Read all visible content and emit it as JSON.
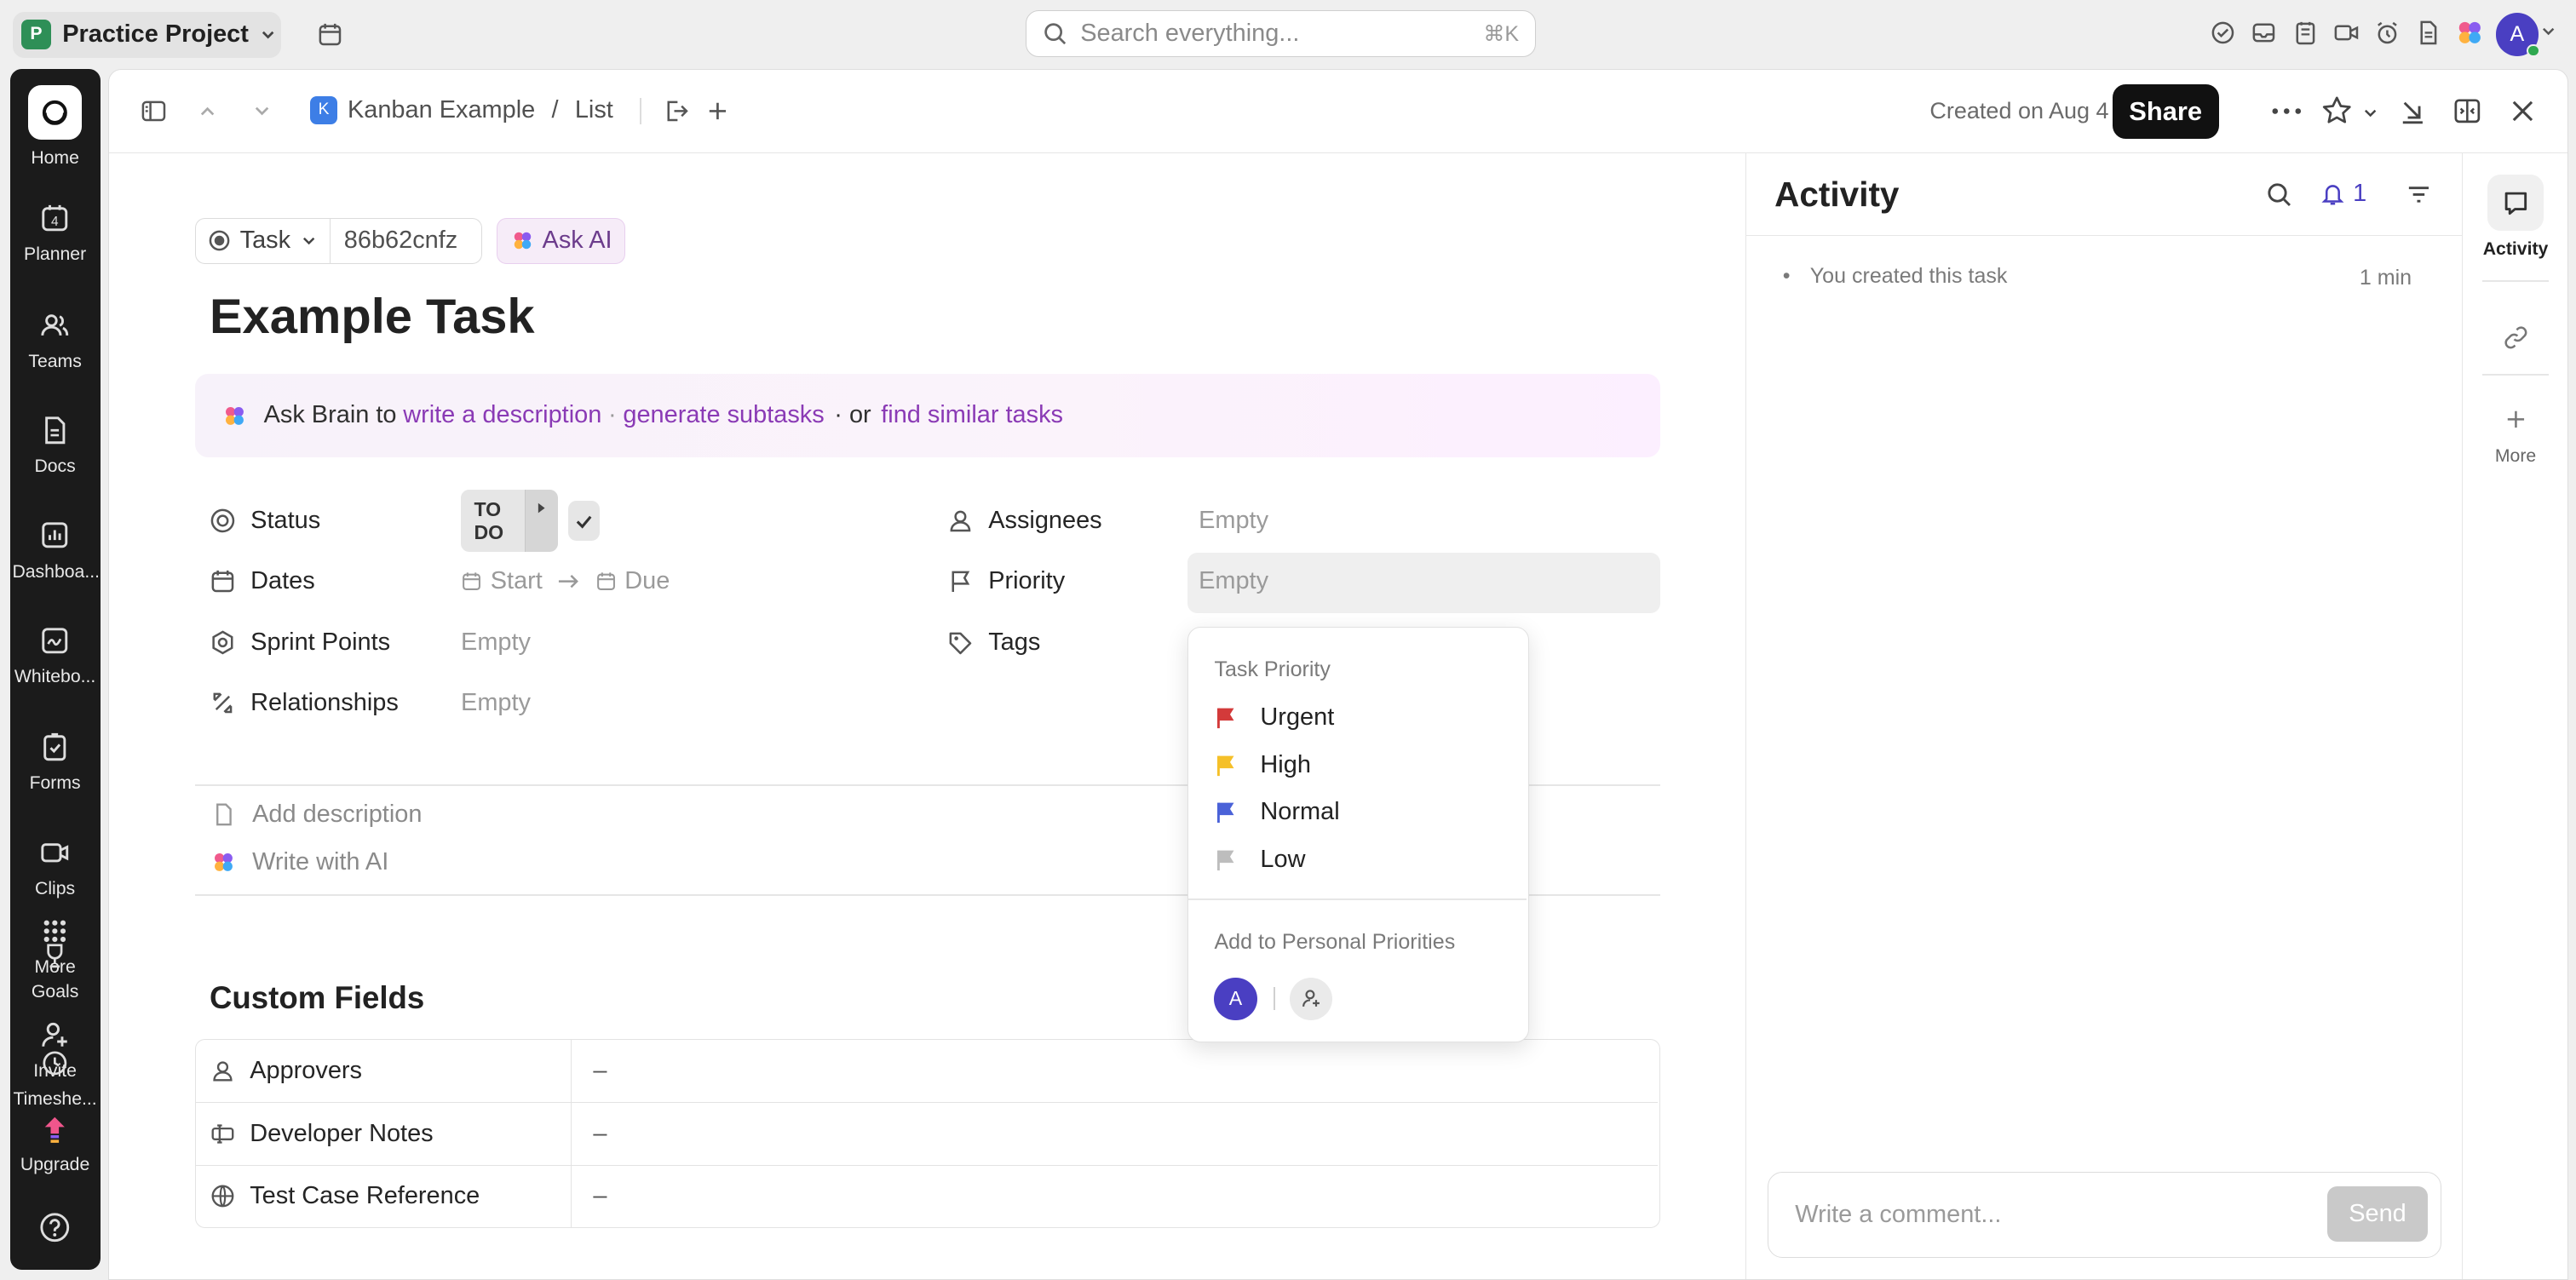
{
  "topbar": {
    "workspace_initial": "P",
    "workspace_name": "Practice Project",
    "search_placeholder": "Search everything...",
    "search_shortcut": "⌘K",
    "user_initial": "A"
  },
  "rail": {
    "items": [
      {
        "label": "Home"
      },
      {
        "label": "Planner",
        "badge": "4"
      },
      {
        "label": "Teams"
      },
      {
        "label": "Docs"
      },
      {
        "label": "Dashboa..."
      },
      {
        "label": "Whitebo..."
      },
      {
        "label": "Forms"
      },
      {
        "label": "Clips"
      },
      {
        "label": "More"
      },
      {
        "label": "Goals"
      },
      {
        "label": "Invite"
      },
      {
        "label": "Timeshe..."
      },
      {
        "label": "Upgrade"
      }
    ]
  },
  "header": {
    "list_initial": "K",
    "breadcrumb_list": "Kanban Example",
    "breadcrumb_sep": "/",
    "breadcrumb_view": "List",
    "created": "Created on Aug 4",
    "share": "Share"
  },
  "task": {
    "type": "Task",
    "id": "86b62cnfz",
    "ask_ai": "Ask AI",
    "title": "Example Task",
    "brain_prefix": "Ask Brain to",
    "brain_link1": "write a description",
    "brain_dot1": "·",
    "brain_link2": "generate subtasks",
    "brain_dot2": "· or",
    "brain_link3": "find similar tasks"
  },
  "fields": {
    "status_label": "Status",
    "status_value": "TO DO",
    "dates_label": "Dates",
    "dates_start": "Start",
    "dates_due": "Due",
    "sprint_label": "Sprint Points",
    "sprint_value": "Empty",
    "relationships_label": "Relationships",
    "relationships_value": "Empty",
    "assignees_label": "Assignees",
    "assignees_value": "Empty",
    "priority_label": "Priority",
    "priority_value": "Empty",
    "tags_label": "Tags"
  },
  "priority_menu": {
    "header": "Task Priority",
    "options": [
      {
        "label": "Urgent",
        "color": "#d33a3a"
      },
      {
        "label": "High",
        "color": "#f5c029"
      },
      {
        "label": "Normal",
        "color": "#4a62d8"
      },
      {
        "label": "Low",
        "color": "#bdbdbd"
      }
    ],
    "personal": "Add to Personal Priorities",
    "avatar_initial": "A"
  },
  "description": {
    "add": "Add description",
    "write_ai": "Write with AI"
  },
  "custom_fields": {
    "heading": "Custom Fields",
    "rows": [
      {
        "label": "Approvers",
        "value": "–"
      },
      {
        "label": "Developer Notes",
        "value": "–"
      },
      {
        "label": "Test Case Reference",
        "value": "–"
      }
    ]
  },
  "activity": {
    "title": "Activity",
    "notif_count": "1",
    "item_text": "You created this task",
    "item_time": "1 min",
    "comment_placeholder": "Write a comment...",
    "send": "Send"
  },
  "right_rail": {
    "activity": "Activity",
    "more": "More"
  },
  "colors": {
    "accent": "#4a3fc2",
    "brain_link": "#8a3ab5",
    "rail_bg": "#1b1b1b"
  }
}
